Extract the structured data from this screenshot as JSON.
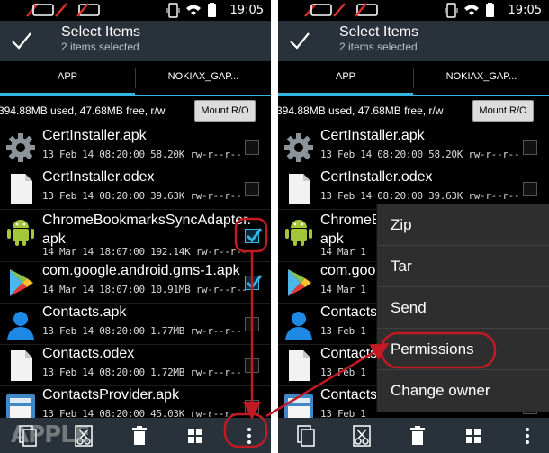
{
  "status_bar": {
    "time": "19:05"
  },
  "action_bar": {
    "title": "Select Items",
    "subtitle": "2 items selected",
    "confirm_icon": "check-icon"
  },
  "tabs": [
    {
      "label": "APP",
      "selected": true
    },
    {
      "label": "NOKIAX_GAP..."
    }
  ],
  "storage": {
    "text": "394.88MB used, 47.68MB free, r/w",
    "mount_label": "Mount R/O"
  },
  "files_left": [
    {
      "name": "CertInstaller.apk",
      "meta": "13 Feb 14 08:20:00 58.20K rw-r--r--",
      "icon": "gear-icon",
      "checked": false
    },
    {
      "name": "CertInstaller.odex",
      "meta": "13 Feb 14 08:20:00 39.63K rw-r--r--",
      "icon": "document-icon",
      "checked": false
    },
    {
      "name": "ChromeBookmarksSyncAdapter.\napk",
      "meta": "14 Mar 14 18:07:00 192.14K rw-r--r--",
      "icon": "android-icon",
      "checked": true
    },
    {
      "name": "com.google.android.gms-1.apk",
      "meta": "14 Mar 14 18:07:00 10.91MB rw-r--r--",
      "icon": "play-store-icon",
      "checked": true
    },
    {
      "name": "Contacts.apk",
      "meta": "13 Feb 14 08:20:00 1.77MB rw-r--r--",
      "icon": "contact-icon",
      "checked": false
    },
    {
      "name": "Contacts.odex",
      "meta": "13 Feb 14 08:20:00 1.72MB rw-r--r--",
      "icon": "document-icon",
      "checked": false
    },
    {
      "name": "ContactsProvider.apk",
      "meta": "13 Feb 14 08:20:00 45.03K rw-r--r--",
      "icon": "contacts-provider-icon",
      "checked": false
    }
  ],
  "files_right": [
    {
      "name": "CertInstaller.apk",
      "meta": "13 Feb 14 08:20:00 58.20K rw-r--r--",
      "icon": "gear-icon"
    },
    {
      "name": "CertInstaller.odex",
      "meta": "13 Feb 14 08:20:00 39.63K rw-r--r--",
      "icon": "document-icon"
    },
    {
      "name": "ChromeB\napk",
      "meta": "14 Mar 1",
      "icon": "android-icon"
    },
    {
      "name": "com.goo",
      "meta": "14 Mar 1",
      "icon": "play-store-icon"
    },
    {
      "name": "Contacts",
      "meta": "13 Feb 1",
      "icon": "contact-icon"
    },
    {
      "name": "Contacts",
      "meta": "13 Feb 1",
      "icon": "document-icon"
    },
    {
      "name": "Contacts",
      "meta": "13 Feb 1",
      "icon": "contacts-provider-icon"
    }
  ],
  "overflow_menu": {
    "items": [
      {
        "label": "Zip"
      },
      {
        "label": "Tar"
      },
      {
        "label": "Send"
      },
      {
        "label": "Permissions",
        "highlighted": true
      },
      {
        "label": "Change owner"
      }
    ]
  },
  "bottom_actions": [
    "copy-icon",
    "cut-icon",
    "delete-icon",
    "select-all-icon",
    "overflow-menu-icon"
  ],
  "watermark": "APPLE",
  "colors": {
    "accent": "#33b5e5",
    "bar": "#29323a",
    "annotation": "#c21a22",
    "menu_bg": "#2e2e2e"
  }
}
